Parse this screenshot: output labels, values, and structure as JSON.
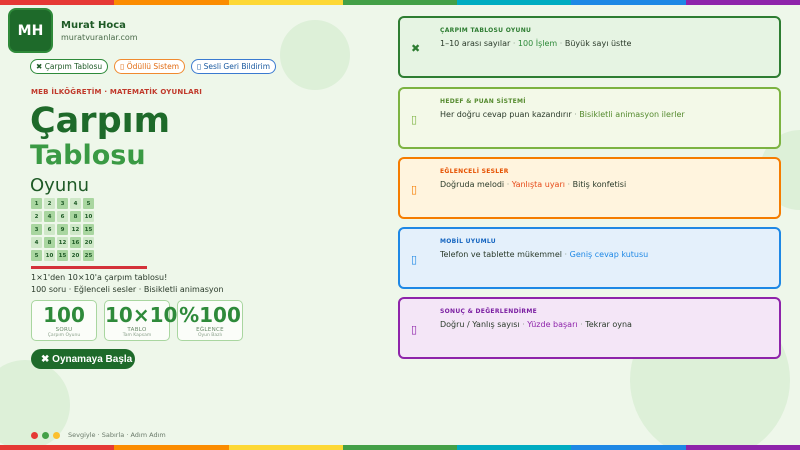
{
  "brand": {
    "logo": "MH",
    "name": "Murat Hoca",
    "url": "muratvuranlar.com"
  },
  "chips": [
    {
      "icon": "✖",
      "label": "Çarpım Tablosu"
    },
    {
      "icon": "▯",
      "label": "Ödüllü Sistem"
    },
    {
      "icon": "▯",
      "label": "Sesli Geri Bildirim"
    }
  ],
  "hero": {
    "subtitle": "MEB İLKÖĞRETİM · MATEMATİK OYUNLARI",
    "title1": "Çarpım",
    "title2": "Tablosu",
    "title3": "Oyunu",
    "desc1": "1×1'den 10×10'a çarpım tablosu!",
    "desc2": "100 soru · Eğlenceli sesler · Bisikletli animasyon"
  },
  "grid": [
    [
      "1",
      "2",
      "3",
      "4",
      "5"
    ],
    [
      "2",
      "4",
      "6",
      "8",
      "10"
    ],
    [
      "3",
      "6",
      "9",
      "12",
      "15"
    ],
    [
      "4",
      "8",
      "12",
      "16",
      "20"
    ],
    [
      "5",
      "10",
      "15",
      "20",
      "25"
    ]
  ],
  "stats": [
    {
      "value": "100",
      "label": "SORU",
      "sub": "Çarpım Oyunu"
    },
    {
      "value": "10×10",
      "label": "TABLO",
      "sub": "Tam Kapsam"
    },
    {
      "value": "%100",
      "label": "EĞLENCE",
      "sub": "Oyun Bazlı"
    }
  ],
  "play_button": {
    "icon": "✖",
    "label": "Oynamaya Başla"
  },
  "footer": {
    "text": "Sevgiyle · Sabırla · Adım Adım",
    "dots": [
      "#e53935",
      "#43a047",
      "#fbc02d"
    ]
  },
  "cards": [
    {
      "icon": "✖",
      "title": "ÇARPIM TABLOSU OYUNU",
      "parts": [
        "1–10 arası sayılar",
        " · ",
        "100 İşlem",
        " · ",
        "Büyük sayı üstte"
      ],
      "color": "#2e7d32",
      "bg": "#e6f4e3"
    },
    {
      "icon": "▯",
      "title": "HEDEF & PUAN SİSTEMİ",
      "parts": [
        "Her doğru cevap puan kazandırır",
        " · ",
        "Bisikletli animasyon ilerler",
        "",
        ""
      ],
      "color": "#7cb342",
      "bg": "#f3f9e8"
    },
    {
      "icon": "▯",
      "title": "EĞLENCELİ SESLER",
      "parts": [
        "Doğruda melodi",
        " · ",
        "Yanlışta uyarı",
        " · ",
        "Bitiş konfetisi"
      ],
      "color": "#f57c00",
      "bg": "#fff4de"
    },
    {
      "icon": "▯",
      "title": "MOBİL UYUMLU",
      "parts": [
        "Telefon ve tablette mükemmel",
        " · ",
        "Geniş cevap kutusu",
        "",
        ""
      ],
      "color": "#1e88e5",
      "bg": "#e4f0fb"
    },
    {
      "icon": "▯",
      "title": "SONUÇ & DEĞERLENDİRME",
      "parts": [
        "Doğru / Yanlış sayısı",
        " · ",
        "Yüzde başarı",
        " · ",
        "Tekrar oyna"
      ],
      "color": "#8e24aa",
      "bg": "#f4e6f7"
    }
  ],
  "rainbow": [
    "#e53935",
    "#fb8c00",
    "#fdd835",
    "#43a047",
    "#00acc1",
    "#1e88e5",
    "#8e24aa"
  ]
}
